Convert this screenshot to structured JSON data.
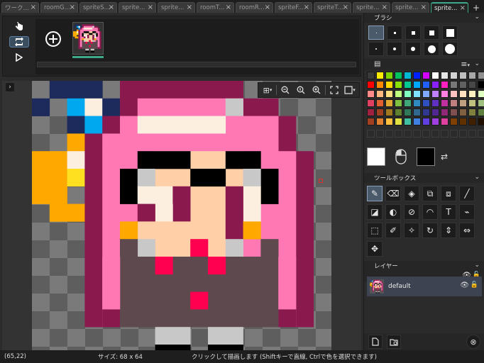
{
  "tabs": [
    {
      "label": "ワーク...",
      "active": false
    },
    {
      "label": "roomG...",
      "active": false
    },
    {
      "label": "spriteS...",
      "active": false
    },
    {
      "label": "sprite...",
      "active": false
    },
    {
      "label": "sprite...",
      "active": false
    },
    {
      "label": "roomT...",
      "active": false
    },
    {
      "label": "roomR...",
      "active": false
    },
    {
      "label": "spriteF...",
      "active": false
    },
    {
      "label": "spriteT...",
      "active": false
    },
    {
      "label": "sprite...",
      "active": false
    },
    {
      "label": "sprite...",
      "active": false
    },
    {
      "label": "sprite...",
      "active": true
    }
  ],
  "tab_add_label": "+",
  "tab_close_glyph": "×",
  "panels": {
    "brush_title": "ブラシ",
    "toolbox_title": "ツールボックス",
    "layer_title": "レイヤー"
  },
  "layer": {
    "name": "default",
    "visible": true
  },
  "status": {
    "coords": "(65,22)",
    "size": "サイズ: 68 x 64",
    "hint": "クリックして描画します (Shiftキーで直線, Ctrlで色を選択できます)"
  },
  "colors": {
    "primary": "#ffffff",
    "secondary": "#000000",
    "accent": "#3fa88b"
  },
  "palette": [
    "#3a3a3a",
    "#ffeb00",
    "#7fd400",
    "#00c060",
    "#00b7d4",
    "#0020ff",
    "#d400ff",
    "#ffffff",
    "#e6e6e6",
    "#d4d4d4",
    "#c0c0c0",
    "#a8a8a8",
    "#909090",
    "#ff0000",
    "#ff8a00",
    "#ffd800",
    "#8ae000",
    "#00c890",
    "#00a8ff",
    "#2060ff",
    "#8a20ff",
    "#ff20c0",
    "#787878",
    "#606060",
    "#484848",
    "#000000",
    "#ff8a8a",
    "#ffb880",
    "#ffe080",
    "#c0ff80",
    "#80ffc0",
    "#80e0ff",
    "#80a8ff",
    "#c080ff",
    "#ff80e0",
    "#ffc0c0",
    "#ffe0c0",
    "#fff0c0",
    "#e0ffc0",
    "#e04060",
    "#e06030",
    "#e0a830",
    "#80c040",
    "#40a878",
    "#3088c0",
    "#3050c0",
    "#6030c0",
    "#c030a0",
    "#c08080",
    "#c0a080",
    "#c0c080",
    "#a0c080",
    "#a02040",
    "#a04020",
    "#a07820",
    "#608030",
    "#307858",
    "#306890",
    "#303890",
    "#502890",
    "#902878",
    "#805050",
    "#806040",
    "#808040",
    "#608040",
    "#a04020",
    "#e08030",
    "#ffc040",
    "#e0e040",
    "#40c0a0",
    "#4080e0",
    "#6040e0",
    "#a040e0",
    "#e040a0",
    "#804000",
    "#603000",
    "#402000",
    "#201000"
  ],
  "icons": {
    "anim_select": "hand-cursor-icon",
    "anim_loop": "loop-icon",
    "anim_play": "play-icon",
    "add_frame": "plus-circle-icon",
    "canvas_expand": "chevron-right-icon",
    "grid": "grid-icon",
    "zoom_out": "zoom-out-icon",
    "zoom_reset": "zoom-reset-icon",
    "zoom_in": "zoom-in-icon",
    "fit": "fit-icon",
    "bg": "background-icon"
  },
  "tools": [
    {
      "name": "pencil-tool",
      "glyph": "✎",
      "selected": true
    },
    {
      "name": "eraser-tool",
      "glyph": "⌫",
      "selected": false
    },
    {
      "name": "fill-tool",
      "glyph": "◈",
      "selected": false
    },
    {
      "name": "copy-tool",
      "glyph": "⧉",
      "selected": false
    },
    {
      "name": "paste-tool",
      "glyph": "⧈",
      "selected": false
    },
    {
      "name": "line-tool",
      "glyph": "╱",
      "selected": false
    },
    {
      "name": "flip-h-tool",
      "glyph": "◪",
      "selected": false
    },
    {
      "name": "circle-fill-tool",
      "glyph": "◐",
      "selected": false
    },
    {
      "name": "no-tool",
      "glyph": "⊘",
      "selected": false
    },
    {
      "name": "arc-tool",
      "glyph": "◠",
      "selected": false
    },
    {
      "name": "text-tool",
      "glyph": "T",
      "selected": false
    },
    {
      "name": "eyedropper-tool",
      "glyph": "⌁",
      "selected": false
    },
    {
      "name": "rect-select-tool",
      "glyph": "⬚",
      "selected": false
    },
    {
      "name": "brush-select-tool",
      "glyph": "✐",
      "selected": false
    },
    {
      "name": "magic-wand-tool",
      "glyph": "✧",
      "selected": false
    },
    {
      "name": "rotate-tool",
      "glyph": "↻",
      "selected": false
    },
    {
      "name": "flip-v-tool",
      "glyph": "⇕",
      "selected": false
    },
    {
      "name": "flip-h2-tool",
      "glyph": "⇔",
      "selected": false
    },
    {
      "name": "move-tool",
      "glyph": "✥",
      "selected": false
    }
  ]
}
